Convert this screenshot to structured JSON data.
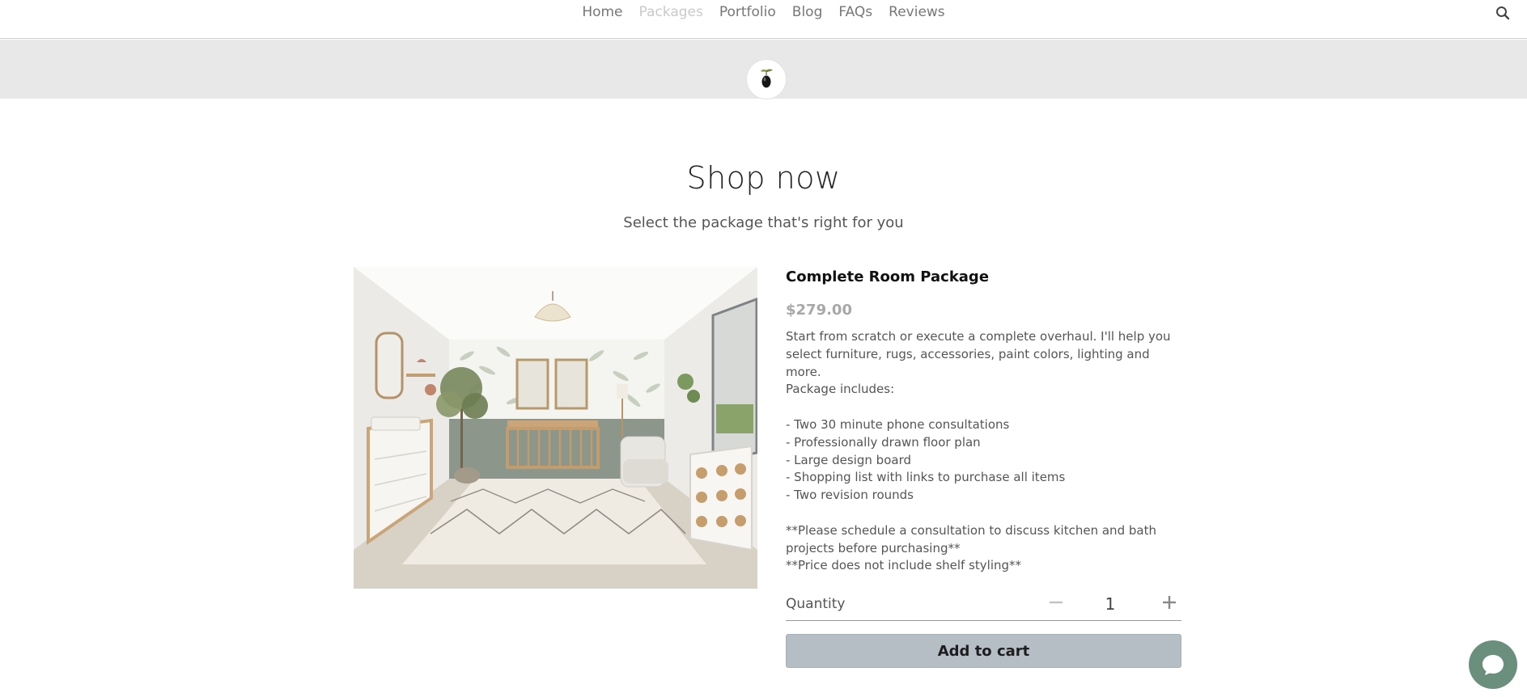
{
  "nav": {
    "items": [
      {
        "label": "Home",
        "active": false
      },
      {
        "label": "Packages",
        "active": true
      },
      {
        "label": "Portfolio",
        "active": false
      },
      {
        "label": "Blog",
        "active": false
      },
      {
        "label": "FAQs",
        "active": false
      },
      {
        "label": "Reviews",
        "active": false
      }
    ],
    "search_icon": "search-icon"
  },
  "hero": {
    "title": "Shop now",
    "subtitle": "Select the package that's right for you"
  },
  "product": {
    "name": "Complete Room Package",
    "price": "$279.00",
    "description_lines": [
      "Start from scratch or execute a complete overhaul. I'll help you",
      "select furniture, rugs, accessories, paint colors, lighting and more.",
      "Package includes:",
      "",
      "- Two 30 minute phone consultations",
      "- Professionally drawn floor plan",
      "- Large design board",
      "- Shopping list with links to purchase all items",
      "- Two revision rounds",
      "",
      "**Please schedule a consultation to discuss kitchen and bath",
      "projects before purchasing**",
      "**Price does not include shelf styling**"
    ],
    "quantity_label": "Quantity",
    "quantity": "1",
    "minus_icon": "minus-icon",
    "plus_icon": "plus-icon",
    "add_to_cart_label": "Add to cart"
  },
  "chat": {
    "icon": "chat-bubble-icon"
  },
  "colors": {
    "button_bg": "#b6bec5",
    "banner_bg": "#e8e8e8",
    "chat_bg": "#6a8f7c",
    "active_nav": "#c9c9c9"
  }
}
